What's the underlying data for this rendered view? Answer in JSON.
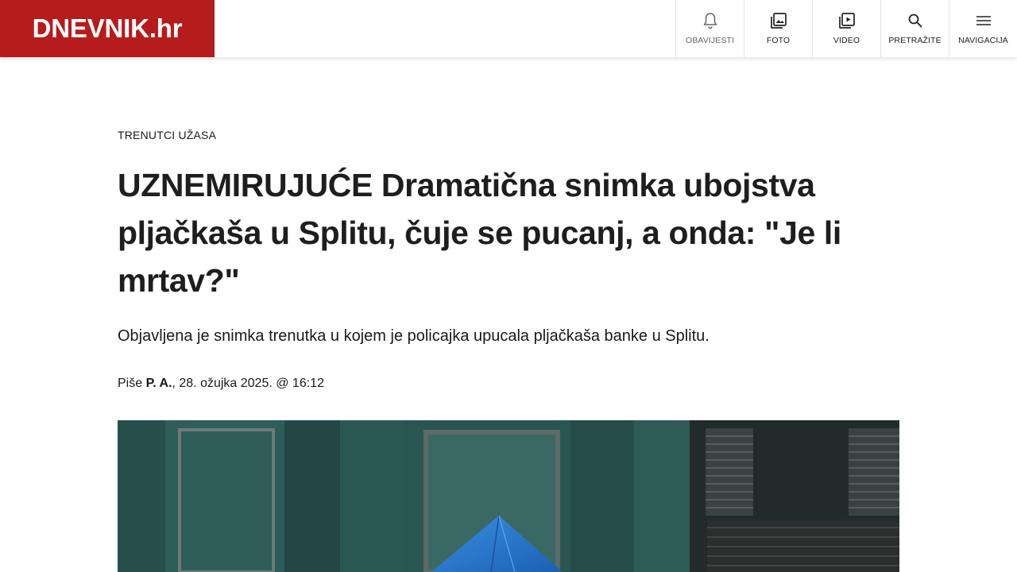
{
  "header": {
    "logo_text": "DNEVNIK.hr",
    "brand_color": "#b61c1c",
    "nav": [
      {
        "label": "OBAVIJESTI",
        "icon": "bell-icon"
      },
      {
        "label": "FOTO",
        "icon": "photo-gallery-icon"
      },
      {
        "label": "VIDEO",
        "icon": "video-play-icon"
      },
      {
        "label": "PRETRAŽITE",
        "icon": "search-icon"
      },
      {
        "label": "NAVIGACIJA",
        "icon": "hamburger-menu-icon"
      }
    ]
  },
  "article": {
    "kicker": "TRENUTCI UŽASA",
    "title": "UZNEMIRUJUĆE Dramatična snimka ubojstva pljačkaša u Splitu, čuje se pucanj, a onda: \"Je li mrtav?\"",
    "lead": "Objavljena je snimka trenutka u kojem je policajka upucala pljačkaša banke u Splitu.",
    "byline": {
      "prefix": "Piše ",
      "author": "P. A.",
      "date": ", 28. ožujka 2025. @ 16:12"
    }
  }
}
